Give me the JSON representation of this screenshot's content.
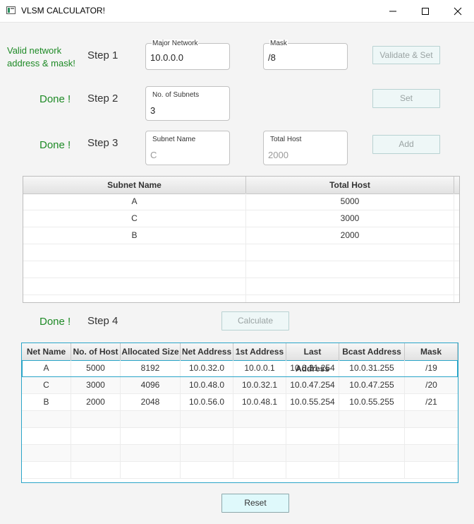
{
  "window": {
    "title": "VLSM CALCULATOR!",
    "icon": "app-window-icon"
  },
  "step1": {
    "status": "Valid network address & mask!",
    "label": "Step 1",
    "major_network": {
      "label": "Major Network",
      "value": "10.0.0.0"
    },
    "mask": {
      "label": "Mask",
      "value": "/8"
    },
    "button": "Validate & Set"
  },
  "step2": {
    "status": "Done !",
    "label": "Step 2",
    "subnets": {
      "label": "No. of Subnets",
      "value": "3"
    },
    "button": "Set"
  },
  "step3": {
    "status": "Done !",
    "label": "Step 3",
    "subnet_name": {
      "label": "Subnet Name",
      "value": "C"
    },
    "total_host": {
      "label": "Total Host",
      "value": "2000"
    },
    "button": "Add"
  },
  "subnet_table": {
    "headers": [
      "Subnet Name",
      "Total Host"
    ],
    "rows": [
      [
        "A",
        "5000"
      ],
      [
        "C",
        "3000"
      ],
      [
        "B",
        "2000"
      ]
    ]
  },
  "step4": {
    "status": "Done !",
    "label": "Step 4",
    "button": "Calculate"
  },
  "result_table": {
    "headers": [
      "Net Name",
      "No. of Host",
      "Allocated Size",
      "Net Address",
      "1st Address",
      "Last Address",
      "Bcast Address",
      "Mask"
    ],
    "rows": [
      [
        "A",
        "5000",
        "8192",
        "10.0.32.0",
        "10.0.0.1",
        "10.0.31.254",
        "10.0.31.255",
        "/19"
      ],
      [
        "C",
        "3000",
        "4096",
        "10.0.48.0",
        "10.0.32.1",
        "10.0.47.254",
        "10.0.47.255",
        "/20"
      ],
      [
        "B",
        "2000",
        "2048",
        "10.0.56.0",
        "10.0.48.1",
        "10.0.55.254",
        "10.0.55.255",
        "/21"
      ]
    ]
  },
  "reset_button": "Reset",
  "colors": {
    "status_green": "#1e8a26",
    "selection_border": "#2aa5c8",
    "reset_bg": "#dff9fb"
  }
}
